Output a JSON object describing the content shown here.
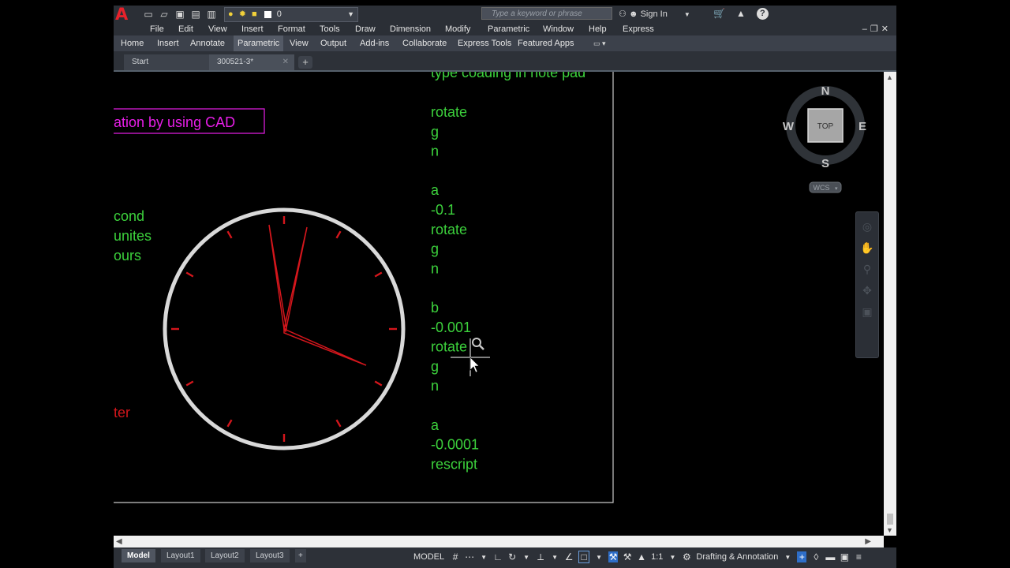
{
  "app": {
    "logo": "A",
    "layer_value": "0",
    "search_placeholder": "Type a keyword or phrase",
    "signin_label": "Sign In"
  },
  "menu": [
    "File",
    "Edit",
    "View",
    "Insert",
    "Format",
    "Tools",
    "Draw",
    "Dimension",
    "Modify",
    "Parametric",
    "Window",
    "Help",
    "Express"
  ],
  "ribbon_tabs": [
    "Home",
    "Insert",
    "Annotate",
    "Parametric",
    "View",
    "Output",
    "Add-ins",
    "Collaborate",
    "Express Tools",
    "Featured Apps"
  ],
  "ribbon_active": "Parametric",
  "file_tabs": [
    {
      "label": "Start"
    },
    {
      "label": "300521-3*"
    }
  ],
  "drawing": {
    "title_fragment": "ation by using CAD",
    "legend": [
      "cond",
      "unites",
      "ours"
    ],
    "bottom_label": "ter",
    "script_header": "type coading in note pad",
    "script_lines": [
      "rotate",
      "g",
      "n",
      "",
      "a",
      "-0.1",
      "rotate",
      "g",
      "n",
      "",
      "b",
      "-0.001",
      "rotate",
      "g",
      "n",
      "",
      "a",
      "-0.0001",
      "rescript"
    ],
    "clock": {
      "hands": [
        "hour",
        "minute",
        "second"
      ]
    },
    "colors": {
      "title_box": "#e81ee8",
      "green_text": "#3cd13c",
      "red": "#d4161c",
      "clock_ring": "#d9d9d9"
    }
  },
  "viewcube": {
    "top": "TOP",
    "n": "N",
    "s": "S",
    "e": "E",
    "w": "W",
    "wcs": "WCS"
  },
  "layout_tabs": [
    "Model",
    "Layout1",
    "Layout2",
    "Layout3"
  ],
  "layout_active": "Model",
  "status": {
    "model": "MODEL",
    "scale": "1:1",
    "workspace": "Drafting & Annotation"
  }
}
